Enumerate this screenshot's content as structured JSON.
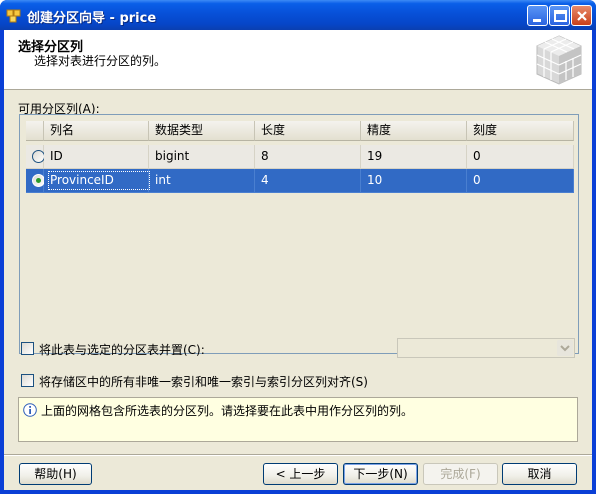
{
  "window": {
    "title": "创建分区向导 - price",
    "controls": {
      "minimize": "minimize-icon",
      "maximize": "maximize-icon",
      "close": "close-icon"
    }
  },
  "header": {
    "title": "选择分区列",
    "subtitle": "选择对表进行分区的列。",
    "logo_icon": "cube-grid-icon"
  },
  "available_columns": {
    "label": "可用分区列(A):",
    "headers": [
      "列名",
      "数据类型",
      "长度",
      "精度",
      "刻度"
    ],
    "rows": [
      {
        "selected": false,
        "name": "ID",
        "type": "bigint",
        "length": "8",
        "precision": "19",
        "scale": "0"
      },
      {
        "selected": true,
        "name": "ProvinceID",
        "type": "int",
        "length": "4",
        "precision": "10",
        "scale": "0"
      }
    ]
  },
  "options": {
    "collocate_label": "将此表与选定的分区表并置(C):",
    "collocate_checked": false,
    "align_label": "将存储区中的所有非唯一索引和唯一索引与索引分区列对齐(S)",
    "align_checked": false
  },
  "info": {
    "icon": "info-icon",
    "text": "上面的网格包含所选表的分区列。请选择要在此表中用作分区列的列。"
  },
  "buttons": {
    "help": "帮助(H)",
    "back": "< 上一步",
    "next": "下一步(N)",
    "finish": "完成(F)",
    "cancel": "取消"
  },
  "colors": {
    "selection": "#316ac5",
    "titlebar": "#0750d8",
    "info_bg": "#ffffe1"
  }
}
